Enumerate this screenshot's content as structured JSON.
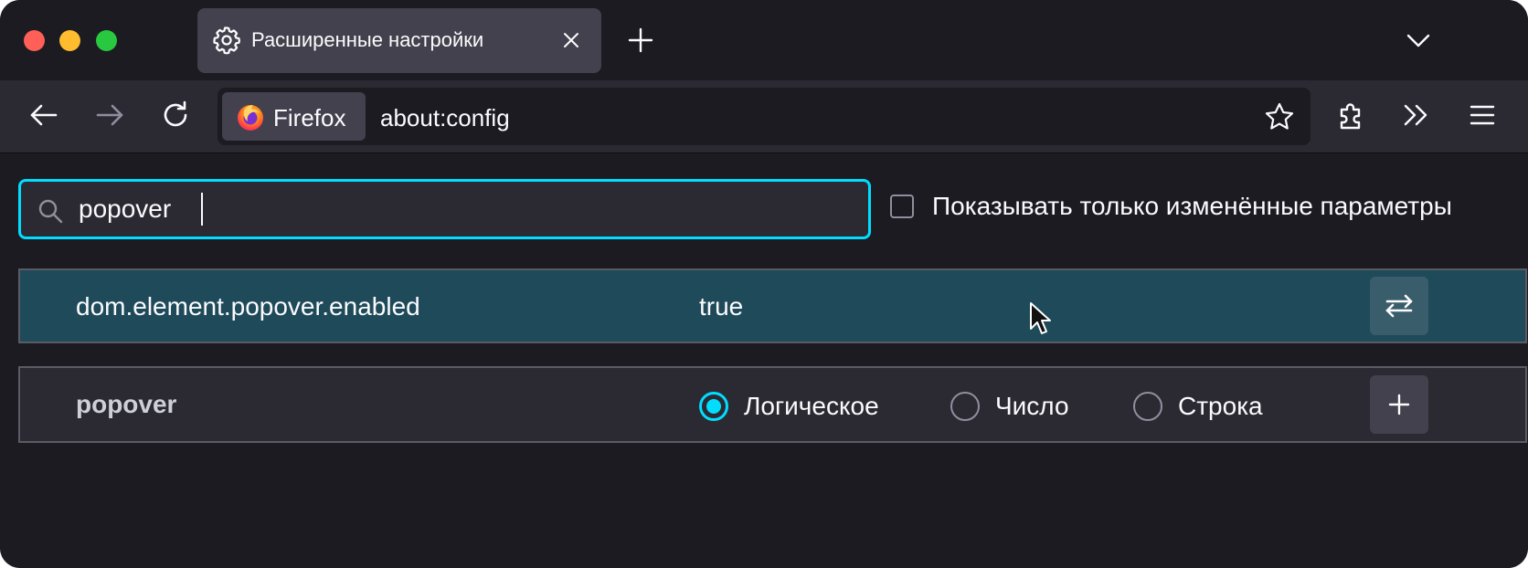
{
  "tab": {
    "title": "Расширенные настройки",
    "icon": "gear-icon"
  },
  "urlbar": {
    "identity_label": "Firefox",
    "url": "about:config"
  },
  "search": {
    "value": "popover",
    "placeholder": ""
  },
  "filters": {
    "modified_only_label": "Показывать только изменённые параметры",
    "modified_only_checked": false
  },
  "prefs": {
    "existing": {
      "name": "dom.element.popover.enabled",
      "value": "true",
      "action_icon": "toggle-icon"
    },
    "new": {
      "name": "popover",
      "types": [
        {
          "label": "Логическое",
          "checked": true
        },
        {
          "label": "Число",
          "checked": false
        },
        {
          "label": "Строка",
          "checked": false
        }
      ],
      "action_icon": "plus-icon"
    }
  },
  "colors": {
    "accent": "#00ddff",
    "highlight_row": "#1f4a5a",
    "window_bg": "#1c1b22",
    "toolbar_bg": "#2b2a33"
  }
}
